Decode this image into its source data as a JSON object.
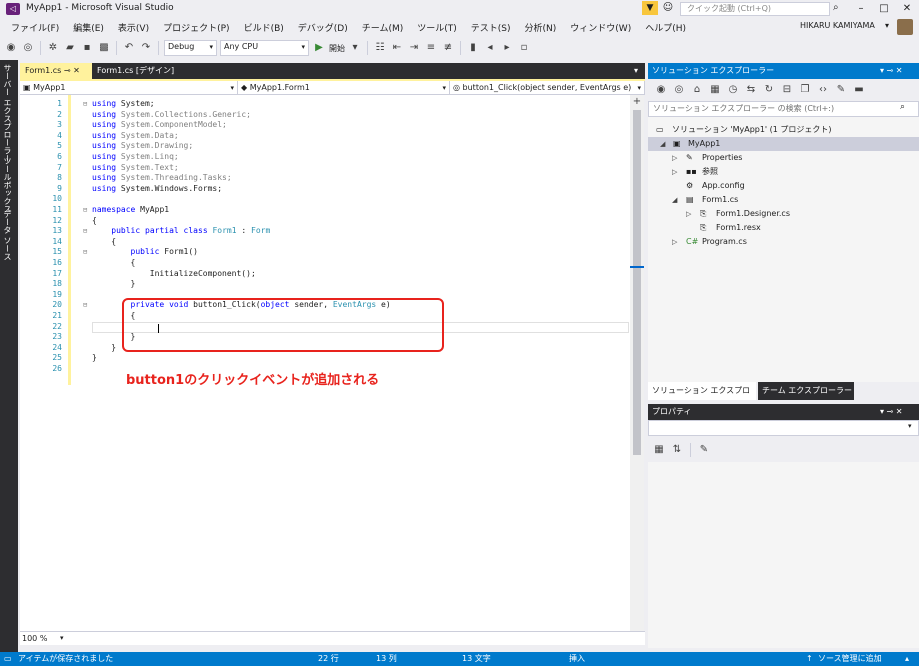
{
  "window": {
    "title": "MyApp1 - Microsoft Visual Studio",
    "quick_launch_placeholder": "クイック起動 (Ctrl+Q)",
    "user": "HIKARU KAMIYAMA"
  },
  "menu": [
    "ファイル(F)",
    "編集(E)",
    "表示(V)",
    "プロジェクト(P)",
    "ビルド(B)",
    "デバッグ(D)",
    "チーム(M)",
    "ツール(T)",
    "テスト(S)",
    "分析(N)",
    "ウィンドウ(W)",
    "ヘルプ(H)"
  ],
  "toolbar": {
    "config": "Debug",
    "platform": "Any CPU",
    "start": "開始"
  },
  "side_tabs": [
    "サーバー エクスプローラー",
    "ツールボックス",
    "データ ソース"
  ],
  "doc_tabs": {
    "tab1": "Form1.cs",
    "tab2": "Form1.cs [デザイン]"
  },
  "navbar": {
    "project": "MyApp1",
    "class": "MyApp1.Form1",
    "member": "button1_Click(object sender, EventArgs e)"
  },
  "code": {
    "lines": [
      {
        "n": "1",
        "t": "using System;"
      },
      {
        "n": "2",
        "t": "using System.Collections.Generic;"
      },
      {
        "n": "3",
        "t": "using System.ComponentModel;"
      },
      {
        "n": "4",
        "t": "using System.Data;"
      },
      {
        "n": "5",
        "t": "using System.Drawing;"
      },
      {
        "n": "6",
        "t": "using System.Linq;"
      },
      {
        "n": "7",
        "t": "using System.Text;"
      },
      {
        "n": "8",
        "t": "using System.Threading.Tasks;"
      },
      {
        "n": "9",
        "t": "using System.Windows.Forms;"
      },
      {
        "n": "10",
        "t": ""
      },
      {
        "n": "11",
        "t": "namespace MyApp1"
      },
      {
        "n": "12",
        "t": "{"
      },
      {
        "n": "13",
        "t": "    public partial class Form1 : Form"
      },
      {
        "n": "14",
        "t": "    {"
      },
      {
        "n": "15",
        "t": "        public Form1()"
      },
      {
        "n": "16",
        "t": "        {"
      },
      {
        "n": "17",
        "t": "            InitializeComponent();"
      },
      {
        "n": "18",
        "t": "        }"
      },
      {
        "n": "19",
        "t": ""
      },
      {
        "n": "20",
        "t": "        private void button1_Click(object sender, EventArgs e)"
      },
      {
        "n": "21",
        "t": "        {"
      },
      {
        "n": "22",
        "t": ""
      },
      {
        "n": "23",
        "t": "        }"
      },
      {
        "n": "24",
        "t": "    }"
      },
      {
        "n": "25",
        "t": "}"
      },
      {
        "n": "26",
        "t": ""
      }
    ],
    "annotation": "button1のクリックイベントが追加される"
  },
  "editor_bottom": {
    "zoom": "100 %"
  },
  "solution_explorer": {
    "title": "ソリューション エクスプローラー",
    "search_placeholder": "ソリューション エクスプローラー の検索 (Ctrl+:)",
    "tree": [
      {
        "label": "ソリューション 'MyApp1' (1 プロジェクト)"
      },
      {
        "label": "MyApp1"
      },
      {
        "label": "Properties"
      },
      {
        "label": "参照"
      },
      {
        "label": "App.config"
      },
      {
        "label": "Form1.cs"
      },
      {
        "label": "Form1.Designer.cs"
      },
      {
        "label": "Form1.resx"
      },
      {
        "label": "Program.cs"
      }
    ],
    "tab_active": "ソリューション エクスプローラー",
    "tab_other": "チーム エクスプローラー"
  },
  "properties": {
    "title": "プロパティ"
  },
  "status": {
    "message": "アイテムが保存されました",
    "line": "22 行",
    "col": "13 列",
    "ch": "13 文字",
    "mode": "挿入",
    "scm": "ソース管理に追加"
  }
}
